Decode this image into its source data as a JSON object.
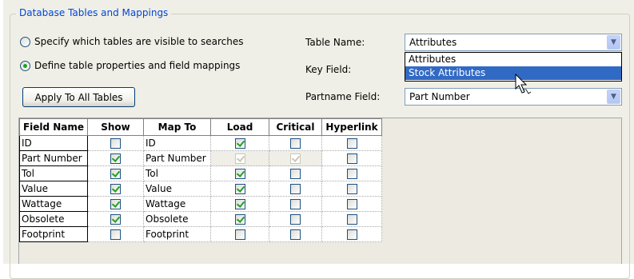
{
  "group": {
    "title": "Database Tables and Mappings"
  },
  "options": [
    {
      "label": "Specify which tables are visible to searches",
      "selected": false
    },
    {
      "label": "Define table properties and field mappings",
      "selected": true
    }
  ],
  "apply_button": "Apply To All Tables",
  "table_name": {
    "label": "Table Name:",
    "value": "Attributes",
    "dropdown_items": [
      "Attributes",
      "Stock Attributes"
    ],
    "highlighted_index": 1
  },
  "key_field": {
    "label": "Key Field:"
  },
  "partname_field": {
    "label": "Partname Field:",
    "value": "Part Number"
  },
  "grid": {
    "columns": [
      "Field Name",
      "Show",
      "Map To",
      "Load",
      "Critical",
      "Hyperlink"
    ],
    "rows": [
      {
        "name": "ID",
        "show": false,
        "map_to": "ID",
        "load": true,
        "critical": false,
        "hyperlink": false,
        "disabled": false
      },
      {
        "name": "Part Number",
        "show": true,
        "map_to": "Part Number",
        "load": true,
        "critical": true,
        "hyperlink": false,
        "disabled": true
      },
      {
        "name": "Tol",
        "show": true,
        "map_to": "Tol",
        "load": true,
        "critical": false,
        "hyperlink": false,
        "disabled": false
      },
      {
        "name": "Value",
        "show": true,
        "map_to": "Value",
        "load": true,
        "critical": false,
        "hyperlink": false,
        "disabled": false
      },
      {
        "name": "Wattage",
        "show": true,
        "map_to": "Wattage",
        "load": true,
        "critical": false,
        "hyperlink": false,
        "disabled": false
      },
      {
        "name": "Obsolete",
        "show": true,
        "map_to": "Obsolete",
        "load": true,
        "critical": false,
        "hyperlink": false,
        "disabled": false
      },
      {
        "name": "Footprint",
        "show": false,
        "map_to": "Footprint",
        "load": false,
        "critical": false,
        "hyperlink": false,
        "disabled": false
      }
    ]
  },
  "icons": {
    "combo_arrow": "chevron-down-icon",
    "cursor": "mouse-pointer-icon"
  }
}
